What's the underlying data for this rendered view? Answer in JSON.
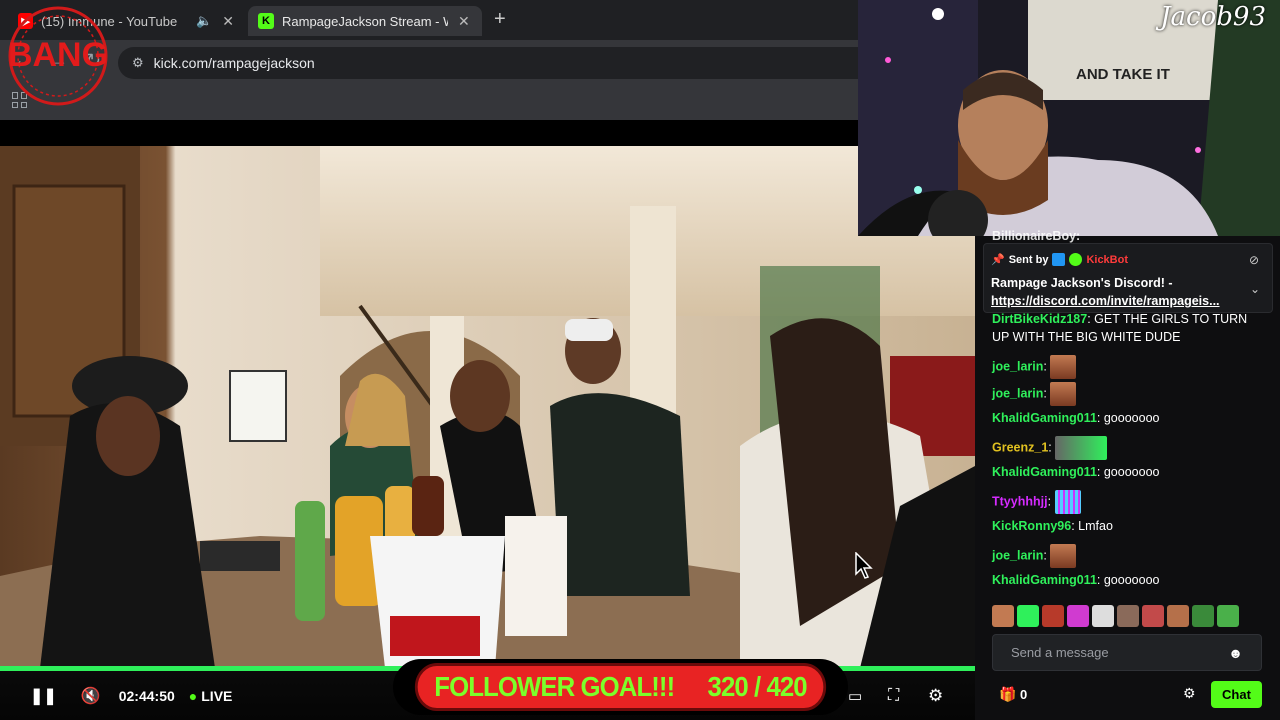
{
  "tabs": [
    {
      "title": "(15) Immune - YouTube",
      "icon": "youtube-icon",
      "color": "#ff0000"
    },
    {
      "title": "RampageJackson Stream - Wat",
      "icon": "kick-icon",
      "color": "#53fc18"
    }
  ],
  "address": {
    "url": "kick.com/rampagejackson"
  },
  "overlay": {
    "bang_logo": "BANG",
    "webcam_name": "Jacob93",
    "poster_text": "AND TAKE IT"
  },
  "player": {
    "time": "02:44:50",
    "live_label": "LIVE"
  },
  "follower_goal": {
    "label": "FOLLOWER GOAL!!!",
    "count": "320 / 420",
    "progress": 0.762
  },
  "pinned": {
    "sent_by": "Sent by",
    "bot": "KickBot",
    "line1": "Rampage Jackson's Discord! -",
    "line2": "https://discord.com/invite/rampageis..."
  },
  "chat": {
    "partial_top": "BillionaireBoy:",
    "messages": [
      {
        "user": "DirtBikeKidz187",
        "text": "GET THE GIRLS TO TURN UP WITH THE BIG WHITE DUDE",
        "color": "#2ff05b"
      },
      {
        "user": "joe_larin",
        "text": "",
        "color": "#2ff05b",
        "emote": "face"
      },
      {
        "user": "joe_larin",
        "text": "",
        "color": "#2ff05b",
        "emote": "face"
      },
      {
        "user": "KhalidGaming011",
        "text": "gooooooo",
        "color": "#2ff05b"
      },
      {
        "user": "Greenz_1",
        "text": "",
        "color": "#e0c020",
        "emote": "rampage"
      },
      {
        "user": "KhalidGaming011",
        "text": "gooooooo",
        "color": "#2ff05b"
      },
      {
        "user": "Ttyyhhhjj",
        "text": "",
        "color": "#d52bff",
        "emote": "bars"
      },
      {
        "user": "KickRonny96",
        "text": "Lmfao",
        "color": "#2ff05b"
      },
      {
        "user": "joe_larin",
        "text": "",
        "color": "#2ff05b",
        "emote": "face"
      },
      {
        "user": "KhalidGaming011",
        "text": "gooooooo",
        "color": "#2ff05b"
      }
    ],
    "input_placeholder": "Send a message",
    "points": "0",
    "chat_button": "Chat"
  }
}
